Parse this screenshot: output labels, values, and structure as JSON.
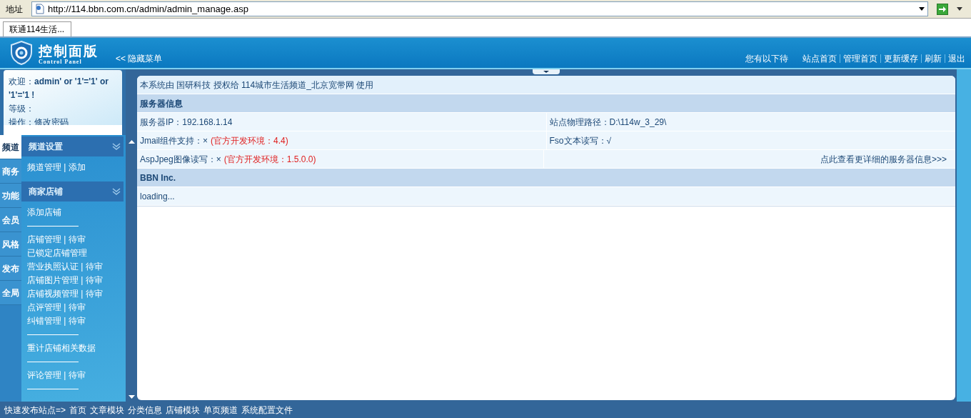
{
  "address_bar": {
    "label": "地址",
    "url": "http://114.bbn.com.cn/admin/admin_manage.asp"
  },
  "browser_tabs": [
    {
      "label": "联通114生活...",
      "selected": true
    }
  ],
  "header": {
    "title": "控制面版",
    "subtitle": "Control Panel",
    "toggle": "<< 隐藏菜单",
    "notice": "您有以下待",
    "links": [
      "站点首页",
      "管理首页",
      "更新缓存",
      "刷新",
      "退出"
    ]
  },
  "welcome": {
    "greeting": "欢迎：**admin' or '1'='1' or '1'='1 !**",
    "level": "等级：",
    "actions": "操作：修改密码"
  },
  "side_tabs": [
    {
      "label": "频道",
      "selected": true
    },
    {
      "label": "商务",
      "selected": false
    },
    {
      "label": "功能",
      "selected": false
    },
    {
      "label": "会员",
      "selected": false
    },
    {
      "label": "风格",
      "selected": false
    },
    {
      "label": "发布",
      "selected": false
    },
    {
      "label": "全局",
      "selected": false
    }
  ],
  "menu_groups": [
    {
      "title": "频道设置",
      "items": [
        {
          "kind": "link",
          "text": "频道管理 | 添加"
        }
      ]
    },
    {
      "title": "商家店铺",
      "items": [
        {
          "kind": "link",
          "text": "添加店铺"
        },
        {
          "kind": "divider"
        },
        {
          "kind": "link",
          "text": "店铺管理 | 待审"
        },
        {
          "kind": "link",
          "text": "已锁定店铺管理"
        },
        {
          "kind": "link",
          "text": "营业执照认证 | 待审"
        },
        {
          "kind": "link",
          "text": "店铺图片管理 | 待审"
        },
        {
          "kind": "link",
          "text": "店铺视频管理 | 待审"
        },
        {
          "kind": "link",
          "text": "点评管理 | 待审"
        },
        {
          "kind": "link",
          "text": "纠错管理 | 待审"
        },
        {
          "kind": "divider"
        },
        {
          "kind": "link",
          "text": "重计店铺相关数据"
        },
        {
          "kind": "divider"
        },
        {
          "kind": "link",
          "text": "评论管理 | 待审"
        },
        {
          "kind": "divider"
        }
      ]
    }
  ],
  "license": "本系统由 国研科技 授权给 114城市生活频道_北京宽带网 使用",
  "sections": [
    {
      "title": "服务器信息",
      "rows": [
        [
          {
            "text": "服务器IP：192.168.1.14"
          },
          {
            "text": "站点物理路径：D:\\114w_3_29\\"
          }
        ],
        [
          {
            "text": "Jmail组件支持：×",
            "note": "(官方开发环境：4.4)"
          },
          {
            "text": "Fso文本读写：√"
          }
        ],
        [
          {
            "text": "AspJpeg图像读写：×",
            "note": "(官方开发环境：1.5.0.0)"
          },
          {
            "text": "点此查看更详细的服务器信息>>>",
            "kind": "link"
          }
        ]
      ]
    },
    {
      "title": "BBN Inc.",
      "rows": [
        [
          {
            "text": "loading..."
          }
        ]
      ]
    }
  ],
  "footer": {
    "label": "快速发布站点=>",
    "links": [
      "首页",
      "文章模块",
      "分类信息",
      "店铺模块",
      "单页频道",
      "系统配置文件"
    ]
  }
}
